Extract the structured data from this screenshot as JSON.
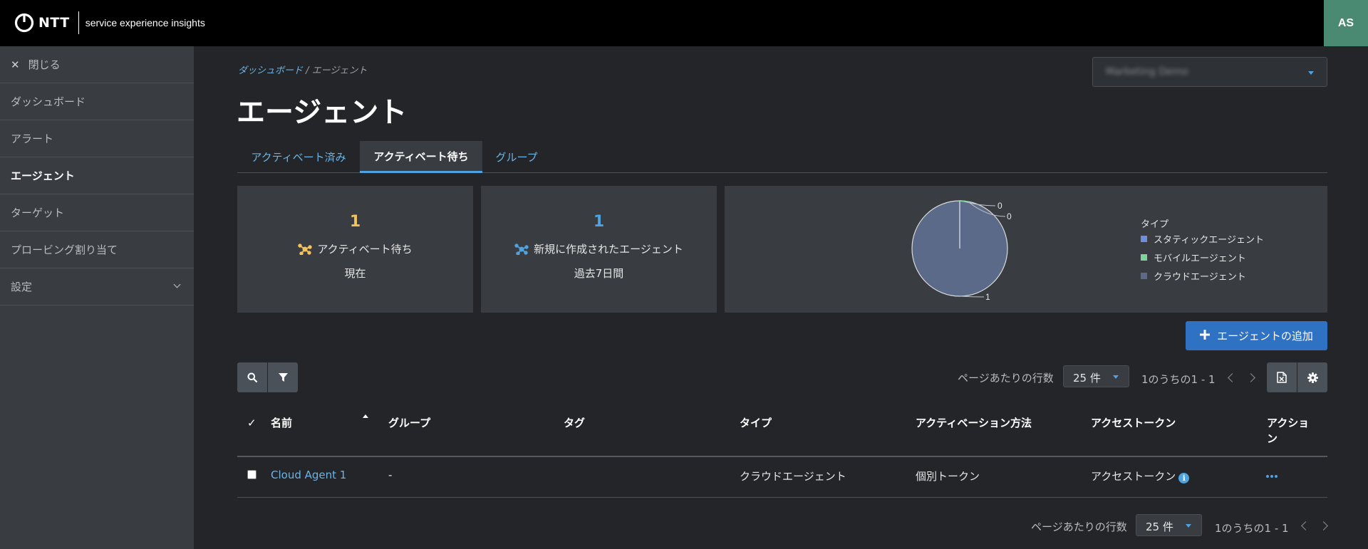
{
  "header": {
    "brand": "NTT",
    "product": "service experience insights",
    "avatar": "AS"
  },
  "sidebar": {
    "close_label": "閉じる",
    "items": [
      {
        "label": "ダッシュボード"
      },
      {
        "label": "アラート"
      },
      {
        "label": "エージェント"
      },
      {
        "label": "ターゲット"
      },
      {
        "label": "プロービング割り当て"
      },
      {
        "label": "設定"
      }
    ]
  },
  "breadcrumb": {
    "parent": "ダッシュボード",
    "separator": "/",
    "current": "エージェント"
  },
  "page_title": "エージェント",
  "env_select": {
    "value": "Marketing Demo"
  },
  "tabs": [
    {
      "label": "アクティベート済み"
    },
    {
      "label": "アクティベート待ち"
    },
    {
      "label": "グループ"
    }
  ],
  "cards": {
    "pending": {
      "count": "1",
      "label": "アクティベート待ち",
      "sub": "現在",
      "color": "#f2c25c"
    },
    "new": {
      "count": "1",
      "label": "新規に作成されたエージェント",
      "sub": "過去7日間",
      "color": "#4fa3e0"
    }
  },
  "chart_data": {
    "type": "pie",
    "legend_title": "タイプ",
    "categories": [
      "スタティックエージェント",
      "モバイルエージェント",
      "クラウドエージェント"
    ],
    "values": [
      0,
      0,
      1
    ],
    "colors": [
      "#6f8ee0",
      "#7fd39b",
      "#5c6a8a"
    ],
    "data_labels": [
      "0",
      "0",
      "1"
    ],
    "legend": "right"
  },
  "add_button_label": "エージェントの追加",
  "pager": {
    "rows_label": "ページあたりの行数",
    "rows_value": "25 件",
    "count": "1のうちの1 - 1"
  },
  "table": {
    "headers": [
      "名前",
      "グループ",
      "タグ",
      "タイプ",
      "アクティベーション方法",
      "アクセストークン",
      "アクショ",
      "ン"
    ],
    "rows": [
      {
        "name": "Cloud Agent 1",
        "group": "-",
        "tag": "",
        "type": "クラウドエージェント",
        "method": "個別トークン",
        "token": "アクセストークン"
      }
    ]
  },
  "icons": {
    "search": "search-icon",
    "filter": "filter-icon",
    "export": "excel-export-icon",
    "settings": "gear-icon",
    "check": "check-icon",
    "sort": "sort-asc-icon",
    "info": "info-icon",
    "more": "more-icon"
  },
  "info_glyph": "i",
  "check_glyph": "✓",
  "close_glyph": "✕"
}
